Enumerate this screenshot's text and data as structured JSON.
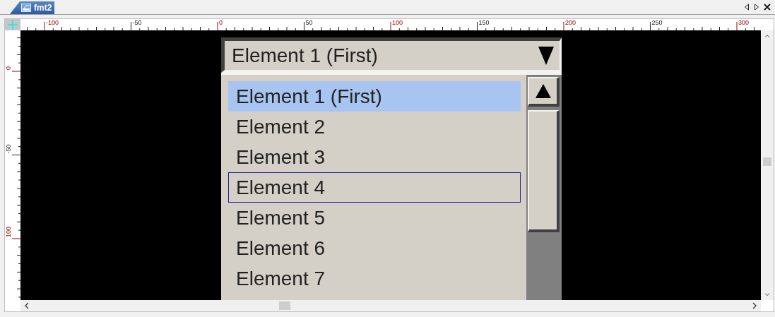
{
  "tab": {
    "title": "fmt2",
    "selected": true
  },
  "ruler": {
    "horizontal": [
      {
        "label": "-100",
        "major": true
      },
      {
        "label": "-50",
        "major": false
      },
      {
        "label": "0",
        "major": true
      },
      {
        "label": "50",
        "major": false
      },
      {
        "label": "100",
        "major": true
      },
      {
        "label": "150",
        "major": false
      },
      {
        "label": "200",
        "major": true
      },
      {
        "label": "250",
        "major": false
      },
      {
        "label": "300",
        "major": true
      }
    ],
    "vertical": [
      {
        "label": "0",
        "major": true
      },
      {
        "label": "-50",
        "major": false
      },
      {
        "label": "100",
        "major": true
      }
    ]
  },
  "combo": {
    "value": "Element 1 (First)",
    "expanded": true
  },
  "list": {
    "items": [
      {
        "label": "Element 1 (First)",
        "selected": true,
        "focused": false
      },
      {
        "label": "Element 2",
        "selected": false,
        "focused": false
      },
      {
        "label": "Element 3",
        "selected": false,
        "focused": false
      },
      {
        "label": "Element 4",
        "selected": false,
        "focused": true
      },
      {
        "label": "Element 5",
        "selected": false,
        "focused": false
      },
      {
        "label": "Element 6",
        "selected": false,
        "focused": false
      },
      {
        "label": "Element 7",
        "selected": false,
        "focused": false
      }
    ]
  }
}
